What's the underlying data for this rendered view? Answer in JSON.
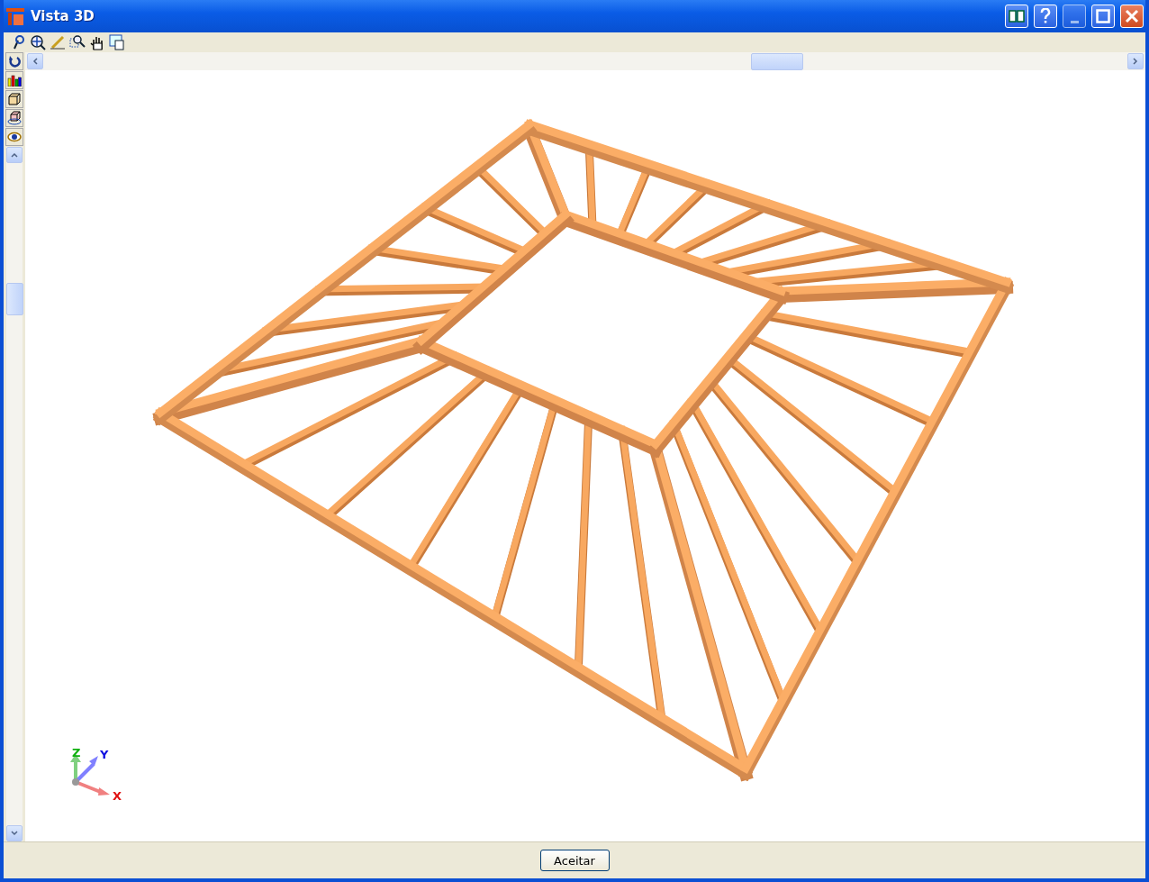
{
  "window": {
    "title": "Vista 3D"
  },
  "axes": {
    "x": "X",
    "y": "Y",
    "z": "Z"
  },
  "buttons": [
    "Aceitar"
  ]
}
